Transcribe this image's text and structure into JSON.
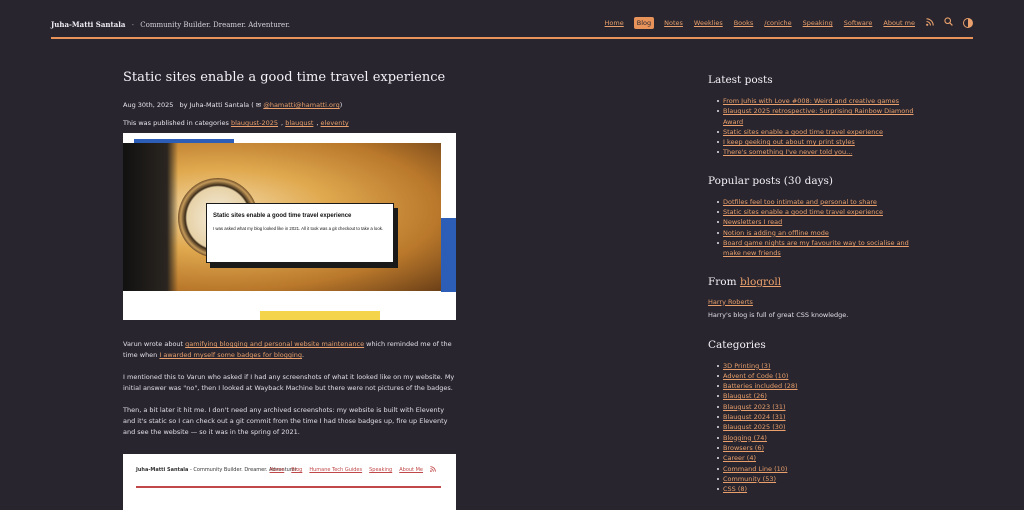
{
  "header": {
    "site_name": "Juha-Matti Santala",
    "separator": "-",
    "tagline": "Community Builder. Dreamer. Adventurer.",
    "nav": [
      "Home",
      "Blog",
      "Notes",
      "Weeklies",
      "Books",
      "/coniche",
      "Speaking",
      "Software",
      "About me"
    ],
    "active_nav": "Blog",
    "icons": [
      "rss-icon",
      "search-icon",
      "theme-toggle-icon"
    ]
  },
  "post": {
    "title": "Static sites enable a good time travel experience",
    "date": "Aug 30th, 2025",
    "by": "by",
    "author": "Juha-Matti Santala",
    "mastodon": "@hamatti@hamatti.org",
    "categories_label": "This was published in categories",
    "categories": [
      "blaugust-2025",
      "blaugust",
      "eleventy"
    ],
    "hero_card_title": "Static sites enable a good time travel experience",
    "hero_card_subtitle": "I was asked what my blog looked like in 2021. All it took was a git checkout to take a look.",
    "paragraph1_pre": "Varun wrote about ",
    "paragraph1_link1": "gamifying blogging and personal website maintenance",
    "paragraph1_mid": " which reminded me of the time when ",
    "paragraph1_link2": "I awarded myself some badges for blogging",
    "paragraph1_post": ".",
    "paragraph2": "I mentioned this to Varun who asked if I had any screenshots of what it looked like on my website. My initial answer was \"no\", then I looked at Wayback Machine but there were not pictures of the badges.",
    "paragraph3": "Then, a bit later it hit me. I don't need any archived screenshots: my website is built with Eleventy and it's static so I can check out a git commit from the time I had those badges up, fire up Eleventy and see the website — so it was in the spring of 2021.",
    "screenshot": {
      "brand": "Juha-Matti Santala",
      "tagline": "- Community Builder. Dreamer. Adventurer.",
      "nav": [
        "Home",
        "Blog",
        "Humane Tech Guides",
        "Speaking",
        "About Me"
      ]
    }
  },
  "sidebar": {
    "latest_title": "Latest posts",
    "latest": [
      "From Juhis with Love #008: Weird and creative games",
      "Blaugust 2025 retrospective: Surprising Rainbow Diamond Award",
      "Static sites enable a good time travel experience",
      "I keep geeking out about my print styles",
      "There's something I've never told you..."
    ],
    "popular_title": "Popular posts (30 days)",
    "popular": [
      "Dotfiles feel too intimate and personal to share",
      "Static sites enable a good time travel experience",
      "Newsletters I read",
      "Notion is adding an offline mode",
      "Board game nights are my favourite way to socialise and make new friends"
    ],
    "blogroll_prefix": "From",
    "blogroll_word": "blogroll",
    "blogroll_name": "Harry Roberts",
    "blogroll_desc": "Harry's blog is full of great CSS knowledge.",
    "categories_title": "Categories",
    "categories": [
      "3D Printing (3)",
      "Advent of Code (10)",
      "Batteries included (28)",
      "Blaugust (26)",
      "Blaugust 2023 (31)",
      "Blaugust 2024 (31)",
      "Blaugust 2025 (30)",
      "Blogging (74)",
      "Browsers (6)",
      "Career (4)",
      "Command Line (10)",
      "Community (53)",
      "CSS (8)"
    ]
  }
}
